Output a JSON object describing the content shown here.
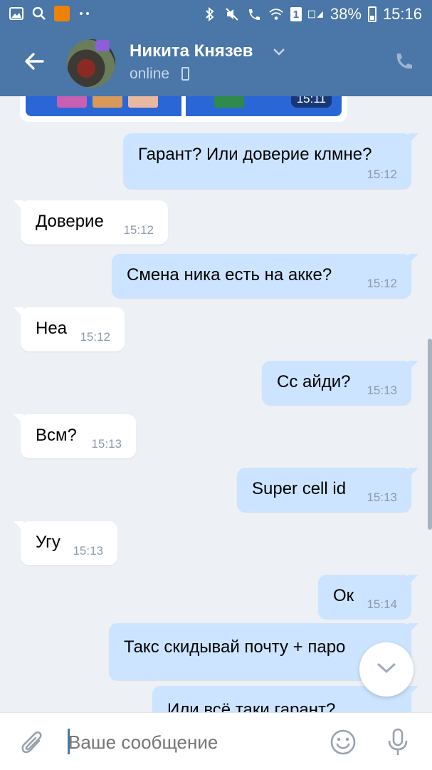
{
  "status_bar": {
    "battery": "38%",
    "time": "15:16",
    "sim": "1"
  },
  "header": {
    "contact_name": "Никита Князев",
    "presence": "online"
  },
  "chat": {
    "image_message": {
      "time": "15:11"
    },
    "messages": [
      {
        "direction": "out",
        "text": "Гарант? Или доверие клмне?",
        "time": "15:12"
      },
      {
        "direction": "in",
        "text": "Доверие",
        "time": "15:12"
      },
      {
        "direction": "out",
        "text": "Смена ника есть на акке?",
        "time": "15:12"
      },
      {
        "direction": "in",
        "text": "Неа",
        "time": "15:12"
      },
      {
        "direction": "out",
        "text": "Сс айди?",
        "time": "15:13"
      },
      {
        "direction": "in",
        "text": "Всм?",
        "time": "15:13"
      },
      {
        "direction": "out",
        "text": "Super cell id",
        "time": "15:13"
      },
      {
        "direction": "in",
        "text": "Угу",
        "time": "15:13"
      },
      {
        "direction": "out",
        "text": "Ок",
        "time": "15:14"
      },
      {
        "direction": "out",
        "text": "Такс скидывай почту + паро",
        "time": ""
      },
      {
        "direction": "out",
        "text": "Или всё таки гарант?",
        "time": ""
      }
    ]
  },
  "composer": {
    "placeholder": "Ваше сообщение"
  },
  "colors": {
    "header": "#4a76a8",
    "background": "#edf0f5",
    "outgoing_bubble": "#cce4ff",
    "incoming_bubble": "#ffffff"
  },
  "icons": [
    "gallery-icon",
    "search-icon",
    "ok-app-icon",
    "more-dots-icon",
    "bluetooth-icon",
    "mute-icon",
    "wifi-call-icon",
    "wifi-icon",
    "sim-icon",
    "signal-icon",
    "battery-icon",
    "back-arrow-icon",
    "chevron-down-icon",
    "phone-icon",
    "call-icon",
    "scroll-down-icon",
    "attach-icon",
    "emoji-icon",
    "mic-icon"
  ]
}
